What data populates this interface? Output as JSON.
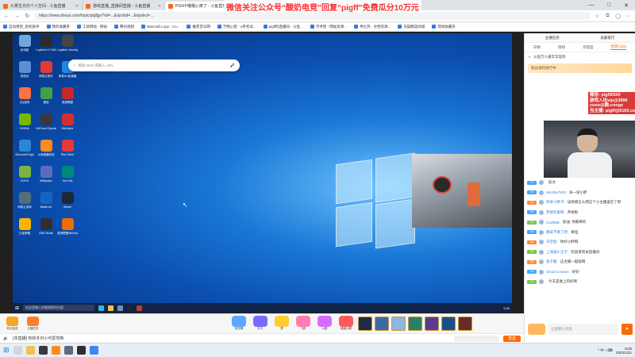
{
  "browser": {
    "tabs": [
      {
        "title": "九霄生日办个人空间 - 斗鱼直播"
      },
      {
        "title": "游戏直播_直播间直播 - 斗鱼直播"
      },
      {
        "title": "PIGFF嘎嘎心爽了 - 斗鱼直播"
      }
    ],
    "new_tab": "+",
    "url": "https://www.douyu.com/topic/pigfjgv?rid=...&dyshid=...&dyshci=...",
    "bookmarks": [
      "自动更新_装机助手",
      "我的收藏夹",
      "工具网站 - 网站",
      "腾讯视频",
      "Warcraft Logs - Co...",
      "推荐音乐网",
      "万物心智 - 2月考试...",
      "pigff的直播间 - 斗鱼...",
      "学术性 - 网站资源...",
      "神之风 - 文档资源...",
      "天猫精选商城",
      "其他收藏夹"
    ],
    "window_min": "—",
    "window_max": "□",
    "window_close": "✕"
  },
  "promo": "微信关注公众号“酸奶电竞”回复“pigff”免费瓜分10万元",
  "remote": {
    "desktop_icons": [
      "此电脑",
      "Logitech G HUB",
      "Logitech Gaming",
      "回收站",
      "网易云音乐",
      "网易UU加速器",
      "QQ游戏",
      "微信",
      "英雄联盟",
      "NVIDIA",
      "GeForce Experience",
      "WeGame",
      "Microsoft Edge",
      "斗鱼直播伴侣",
      "Riot Client",
      "KOOK",
      "Wallpaper",
      "Aim Lab",
      "网易云游戏",
      "Battle.net",
      "Steam",
      "王者荣耀",
      "OBS Studio",
      "英雄联盟WeGame版"
    ],
    "search_placeholder": "搜索 Web 或输入 URL",
    "search_mic": "🎤",
    "taskbar_search": "在这里输入你要搜索的内容",
    "time": "9:26"
  },
  "player": {
    "left_items": [
      {
        "label": "粉丝抽奖"
      },
      {
        "label": "主播任务"
      }
    ],
    "gifts": [
      {
        "label": "荧光棒"
      },
      {
        "label": "办卡"
      },
      {
        "label": "赞"
      },
      {
        "label": "飞机"
      },
      {
        "label": "火箭"
      },
      {
        "label": "超级火箭"
      }
    ],
    "marquee": "[本直播] 你的冬日小可爱驾到",
    "send_label": "发送"
  },
  "chat": {
    "top_items": [
      "主播任务",
      "贡献排行"
    ],
    "tabs": [
      "日榜",
      "周榜",
      "亲密度",
      "贵宾(183)"
    ],
    "tab_active_index": 3,
    "first_line": "斗鱼万人嘉年华现场",
    "banner": "粉丝福利进行中",
    "notice": [
      "微信: pigff2500",
      "游戏入坑vip@3896",
      "cooo@鹅:cooge",
      "当主播: pigff@6163.com"
    ],
    "messages": [
      {
        "lv": "17",
        "lv_color": "#47a6ff",
        "name": "",
        "text": "赵文"
      },
      {
        "lv": "18",
        "lv_color": "#47a6ff",
        "name": "dunzhe7843:",
        "text": "早一早小胖"
      },
      {
        "lv": "21",
        "lv_color": "#ff8a3c",
        "name": "阿呆小胖子:",
        "text": "该想想怎么把这个小主播送走了吧"
      },
      {
        "lv": "16",
        "lv_color": "#47a6ff",
        "name": "梦想北极熊:",
        "text": "开始啦"
      },
      {
        "lv": "12",
        "lv_color": "#7ac74f",
        "name": "CXZ886:",
        "text": "加油, 你最棒的"
      },
      {
        "lv": "19",
        "lv_color": "#47a6ff",
        "name": "那就不要了吧:",
        "text": "奇怪"
      },
      {
        "lv": "15",
        "lv_color": "#ff8a3c",
        "name": "天空鱼:",
        "text": "你好小胖啊"
      },
      {
        "lv": "13",
        "lv_color": "#7ac74f",
        "name": "上海滩小王子:",
        "text": "欢迎来到本直播间"
      },
      {
        "lv": "20",
        "lv_color": "#ff8a3c",
        "name": "鱼子酱:",
        "text": "这主播一般般啊"
      },
      {
        "lv": "14",
        "lv_color": "#47a6ff",
        "name": "Cloud Cocoon:",
        "text": "好好"
      },
      {
        "lv": "12",
        "lv_color": "#7ac74f",
        "name": "",
        "text": "今天是谁上的好啊"
      }
    ],
    "input_placeholder": "让我输入内容",
    "send_label": "➤"
  },
  "host": {
    "start": "⊞",
    "tray": "^ 中 ♪ ⌨",
    "time": "9:26",
    "date": "2023/1/21"
  }
}
